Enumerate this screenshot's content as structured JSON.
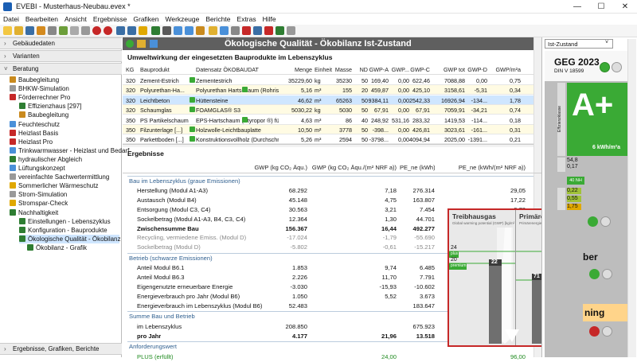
{
  "window": {
    "title": "EVEBI - Musterhaus-Neubau.evex *",
    "min": "—",
    "max": "☐",
    "close": "✕"
  },
  "menu": [
    "Datei",
    "Bearbeiten",
    "Ansicht",
    "Ergebnisse",
    "Grafiken",
    "Werkzeuge",
    "Berichte",
    "Extras",
    "Hilfe"
  ],
  "sidebar": {
    "sections": {
      "gebaeude": "Gebäudedaten",
      "varianten": "Varianten",
      "beratung": "Beratung",
      "ergebnisse": "Ergebnisse, Grafiken, Berichte"
    },
    "tree": [
      {
        "label": "Baubegleitung",
        "level": 1,
        "color": "#c98a1e"
      },
      {
        "label": "BHKW-Simulation",
        "level": 1,
        "color": "#999"
      },
      {
        "label": "Förderrechner Pro",
        "level": 1,
        "color": "#c62828"
      },
      {
        "label": "Effizienzhaus [297]",
        "level": 2,
        "color": "#2e7d32"
      },
      {
        "label": "Baubegleitung",
        "level": 2,
        "color": "#c98a1e"
      },
      {
        "label": "Feuchteschutz",
        "level": 1,
        "color": "#4a90d9"
      },
      {
        "label": "Heizlast Basis",
        "level": 1,
        "color": "#c62828"
      },
      {
        "label": "Heizlast Pro",
        "level": 1,
        "color": "#c62828"
      },
      {
        "label": "Trinkwarmwasser - Heizlast und Bedarf",
        "level": 1,
        "color": "#4a90d9"
      },
      {
        "label": "hydraulischer Abgleich",
        "level": 1,
        "color": "#2e7d32"
      },
      {
        "label": "Lüftungskonzept",
        "level": 1,
        "color": "#4a90d9"
      },
      {
        "label": "vereinfachte Sachwertermittlung",
        "level": 1,
        "color": "#999"
      },
      {
        "label": "Sommerlicher Wärmeschutz",
        "level": 1,
        "color": "#e0a800"
      },
      {
        "label": "Strom-Simulation",
        "level": 1,
        "color": "#999"
      },
      {
        "label": "Stromspar-Check",
        "level": 1,
        "color": "#e0a800"
      },
      {
        "label": "Nachhaltigkeit",
        "level": 1,
        "color": "#2e7d32"
      },
      {
        "label": "Einstellungen - Lebenszyklus",
        "level": 2,
        "color": "#2e7d32"
      },
      {
        "label": "Konfiguration - Bauprodukte",
        "level": 2,
        "color": "#2e7d32"
      },
      {
        "label": "Ökologische Qualität - Ökobilanz",
        "level": 2,
        "color": "#2e7d32"
      },
      {
        "label": "Ökobilanz - Grafik",
        "level": 3,
        "color": "#2e7d32"
      }
    ]
  },
  "main": {
    "title": "Ökologische Qualität - Ökobilanz Ist-Zustand",
    "umwelt_title": "Umweltwirkung der eingesetzten Bauprodukte im Lebenszyklus",
    "columns": [
      "KG",
      "Bauprodukt",
      "Datensatz ÖKOBAUDAT",
      "Menge",
      "Einheit",
      "Masse",
      "ND",
      "GWP-A",
      "GWP...",
      "GWP-C",
      "GWP tot",
      "GWP-D",
      "GWP/m²a"
    ],
    "rows": [
      {
        "kg": "320",
        "produkt": "Zement-Estrich",
        "datensatz": "Zementestrich",
        "menge": "35229,60",
        "einheit": "kg",
        "masse": "35230",
        "nd": "50",
        "gwpa": "169,40",
        "gwpb": "0,00",
        "gwpc": "622,46",
        "tot": "7088,88",
        "gwpd": "0,00",
        "m2a": "0,75"
      },
      {
        "kg": "320",
        "produkt": "Polyurethan-Ha...",
        "datensatz": "Polyurethan Hartschaum (Rohris...",
        "menge": "5,16",
        "einheit": "m³",
        "masse": "155",
        "nd": "20",
        "gwpa": "459,87",
        "gwpb": "0,00",
        "gwpc": "425,10",
        "tot": "3158,61",
        "gwpd": "-5,31",
        "m2a": "0,34"
      },
      {
        "kg": "320",
        "produkt": "Leichtbeton",
        "datensatz": "Hüttensteine",
        "menge": "46,62",
        "einheit": "m³",
        "masse": "65263",
        "nd": "50",
        "gwpa": "9384,11",
        "gwpb": "0,00",
        "gwpc": "2542,33",
        "tot": "16926,94",
        "gwpd": "-134...",
        "m2a": "1,78"
      },
      {
        "kg": "320",
        "produkt": "Schaumglas",
        "datensatz": "FOAMGLAS® S3",
        "menge": "5030,22",
        "einheit": "kg",
        "masse": "5030",
        "nd": "50",
        "gwpa": "67,91",
        "gwpb": "0,00",
        "gwpc": "67,91",
        "tot": "7059,91",
        "gwpd": "-34,21",
        "m2a": "0,74"
      },
      {
        "kg": "350",
        "produkt": "PS Partikelschaum",
        "datensatz": "EPS-Hartschaum (Styropor ®) fü...",
        "menge": "4,63",
        "einheit": "m³",
        "masse": "86",
        "nd": "40",
        "gwpa": "248,92",
        "gwpb": "531,16",
        "gwpc": "283,32",
        "tot": "1419,53",
        "gwpd": "-114...",
        "m2a": "0,18"
      },
      {
        "kg": "350",
        "produkt": "Filzunterlage [...]",
        "datensatz": "Holzwolle-Leichtbauplatte",
        "menge": "10,50",
        "einheit": "m²",
        "masse": "3778",
        "nd": "50",
        "gwpa": "-398...",
        "gwpb": "0,00",
        "gwpc": "426,81",
        "tot": "3023,61",
        "gwpd": "-161...",
        "m2a": "0,31"
      },
      {
        "kg": "350",
        "produkt": "Parkettboden [...]",
        "datensatz": "Konstruktionsvollholz (Durchschni...",
        "menge": "5,26",
        "einheit": "m³",
        "masse": "2594",
        "nd": "50",
        "gwpa": "-3798...",
        "gwpb": "0,00",
        "gwpc": "4094,94",
        "tot": "2025,00",
        "gwpd": "-1391...",
        "m2a": "0,21"
      }
    ],
    "ergebnisse_title": "Ergebnisse",
    "erg_columns": [
      "GWP (kg CO₂ Äqu.)",
      "GWP (kg CO₂ Äqu./(m² NRF a))",
      "PE_ne (kWh)",
      "PE_ne (kWh/(m² NRF a))"
    ],
    "erg_rows": [
      {
        "type": "group",
        "label": "Bau im Lebenszyklus (graue Emissionen)"
      },
      {
        "type": "row",
        "label": "Herstellung (Modul A1-A3)",
        "v1": "68.292",
        "v2": "7,18",
        "v3": "276.314",
        "v4": "29,05"
      },
      {
        "type": "row",
        "label": "Austausch (Modul B4)",
        "v1": "45.148",
        "v2": "4,75",
        "v3": "163.807",
        "v4": "17,22"
      },
      {
        "type": "row",
        "label": "Entsorgung (Modul C3, C4)",
        "v1": "30.563",
        "v2": "3,21",
        "v3": "7.454",
        "v4": "0,78"
      },
      {
        "type": "row",
        "label": "Sockelbetrag (Modul A1-A3, B4, C3, C4)",
        "v1": "12.364",
        "v2": "1,30",
        "v3": "44.701",
        "v4": "4,70"
      },
      {
        "type": "bold",
        "label": "Zwischensumme Bau",
        "v1": "156.367",
        "v2": "16,44",
        "v3": "492.277",
        "v4": "51,75"
      },
      {
        "type": "gray",
        "label": "Recycling, vermiedene Emiss. (Modul D)",
        "v1": "-17.024",
        "v2": "-1,79",
        "v3": "-55.690",
        "v4": ""
      },
      {
        "type": "gray",
        "label": "Sockelbetrag (Modul D)",
        "v1": "-5.802",
        "v2": "-0,61",
        "v3": "-15.217",
        "v4": ""
      },
      {
        "type": "group",
        "label": "Betrieb (schwarze Emissionen)"
      },
      {
        "type": "row",
        "label": "Anteil Modul B6.1",
        "v1": "1.853",
        "v2": "9,74",
        "v3": "6.485",
        "v4": ""
      },
      {
        "type": "row",
        "label": "Anteil Modul B6.3",
        "v1": "2.226",
        "v2": "11,70",
        "v3": "7.791",
        "v4": ""
      },
      {
        "type": "row",
        "label": "Eigengenutzte erneuerbare Energie",
        "v1": "-3.030",
        "v2": "-15,93",
        "v3": "-10.602",
        "v4": ""
      },
      {
        "type": "row",
        "label": "Energieverbrauch pro Jahr (Modul B6)",
        "v1": "1.050",
        "v2": "5,52",
        "v3": "3.673",
        "v4": ""
      },
      {
        "type": "row",
        "label": "Energieverbrauch im Lebenszyklus (Modul B6)",
        "v1": "52.483",
        "v2": "",
        "v3": "183.647",
        "v4": ""
      },
      {
        "type": "group",
        "label": "Summe Bau und Betrieb"
      },
      {
        "type": "row",
        "label": "im Lebenszyklus",
        "v1": "208.850",
        "v2": "",
        "v3": "675.923",
        "v4": ""
      },
      {
        "type": "bold",
        "label": "pro Jahr",
        "v1": "4.177",
        "v2": "21,96",
        "v3": "13.518",
        "v4": ""
      },
      {
        "type": "group",
        "label": "Anforderungswert"
      },
      {
        "type": "green",
        "label": "PLUS (erfüllt)",
        "v1": "",
        "v2": "24,00",
        "v3": "",
        "v4": "96,00"
      }
    ],
    "chart": {
      "left_title": "Treibhausgas",
      "left_sub": "Global warming potential (GWP) [kg/m²a]",
      "right_title": "Primärenergie",
      "right_sub": "Primärenergie, nicht erneuerbar (PE_ne) [kWh/m²a]",
      "left_plus": "24",
      "left_plus_label": "plus",
      "left_premium": "20",
      "left_premium_label": "premium",
      "left_value": "22",
      "right_plus": "96",
      "right_plus_label": "plus",
      "right_premium": "64",
      "right_premium_label": "premium",
      "right_value": "71"
    }
  },
  "right": {
    "select": "Ist-Zustand",
    "geg": "GEG 2023",
    "din": "DIN V 18599",
    "label_a": "A+",
    "unit": "6 kWh/m²a",
    "effizienz": "Effizienzklasse",
    "val1": "54,8",
    "val2": "0,17",
    "tag_green": "40 NH",
    "val3": "0,22",
    "val4": "0,55",
    "val5": "1,75",
    "partial1": "ber",
    "partial2": "ning",
    "accent": "#3aaa35"
  }
}
